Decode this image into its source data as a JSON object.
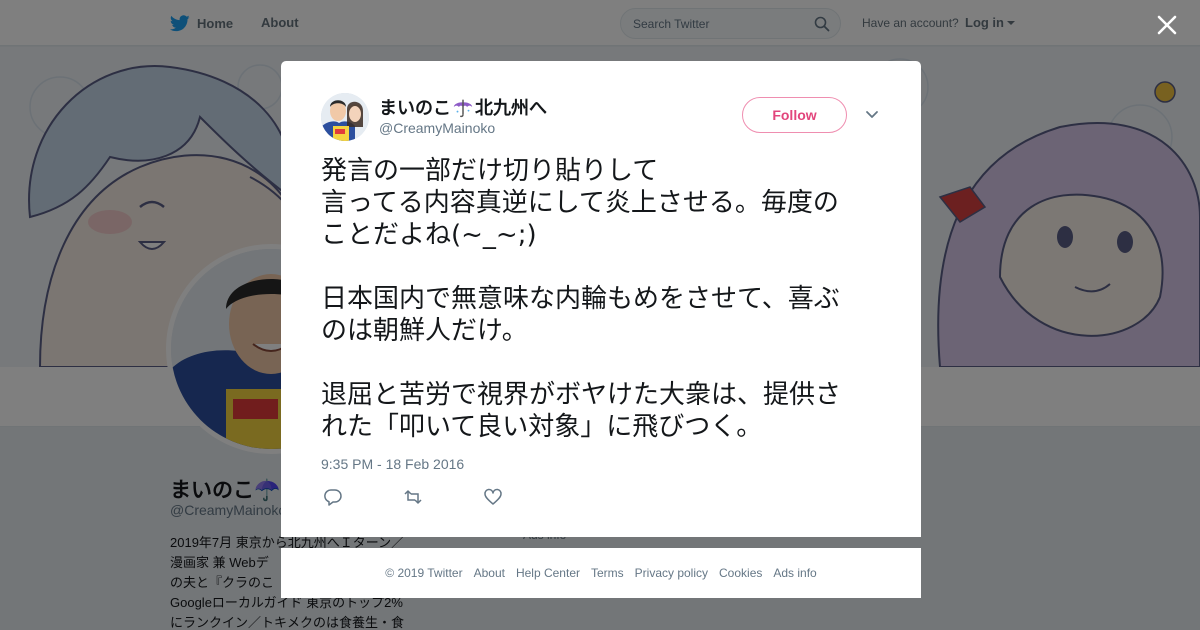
{
  "topnav": {
    "home_label": "Home",
    "about_label": "About",
    "search_placeholder": "Search Twitter",
    "have_account": "Have an account?",
    "login_label": "Log in"
  },
  "profile": {
    "name": "まいのこ☂️",
    "handle": "@CreamyMainoko",
    "bio_lines": [
      "2019年7月 東京から北九州へＩターン／",
      "漫画家 兼 Webデ",
      "の夫と『クラのこ",
      "Googleローカルガイド 東京のトップ2%",
      "にランクイン／トキメクのは食養生・食"
    ],
    "ads_info": "Ads info"
  },
  "tweet": {
    "display_name": "まいのこ",
    "name_suffix": "北九州へ",
    "handle": "@CreamyMainoko",
    "follow_label": "Follow",
    "paragraphs": [
      [
        "発言の一部だけ切り貼りして",
        "言ってる内容真逆にして炎上させる。毎度の",
        "ことだよね(~_~;)"
      ],
      [
        "日本国内で無意味な内輪もめをさせて、喜ぶ",
        "のは朝鮮人だけ。"
      ],
      [
        "退屈と苦労で視界がボヤけた大衆は、提供さ",
        "れた「叩いて良い対象」に飛びつく。"
      ]
    ],
    "timestamp": "9:35 PM - 18 Feb 2016"
  },
  "footer": {
    "links": [
      "© 2019 Twitter",
      "About",
      "Help Center",
      "Terms",
      "Privacy policy",
      "Cookies",
      "Ads info"
    ]
  },
  "colors": {
    "follow_accent": "#e2457c",
    "twitter_blue": "#1da1f2",
    "overlay": "rgba(0,0,0,0.5)"
  }
}
